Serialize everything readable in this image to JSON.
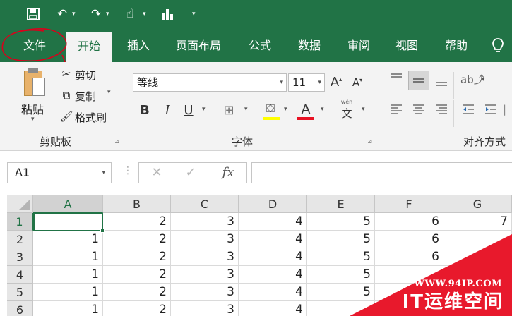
{
  "tabs": {
    "file": "文件",
    "home": "开始",
    "insert": "插入",
    "layout": "页面布局",
    "formulas": "公式",
    "data": "数据",
    "review": "审阅",
    "view": "视图",
    "help": "帮助"
  },
  "clipboard": {
    "paste": "粘贴",
    "cut": "剪切",
    "copy": "复制",
    "format_painter": "格式刷",
    "group_label": "剪贴板"
  },
  "font": {
    "name": "等线",
    "size": "11",
    "bold": "B",
    "italic": "I",
    "underline": "U",
    "font_color_glyph": "A",
    "phonetic_top": "wén",
    "phonetic_bottom": "文",
    "group_label": "字体",
    "fill_color": "#ffff00",
    "font_color": "#e81123"
  },
  "alignment": {
    "group_label": "对齐方式"
  },
  "formula_bar": {
    "name_box": "A1",
    "cancel": "✕",
    "enter": "✓",
    "fx": "fx",
    "value": ""
  },
  "sheet": {
    "columns": [
      "A",
      "B",
      "C",
      "D",
      "E",
      "F",
      "G"
    ],
    "rows": [
      {
        "num": "1",
        "cells": [
          "",
          "2",
          "3",
          "4",
          "5",
          "6",
          "7"
        ]
      },
      {
        "num": "2",
        "cells": [
          "1",
          "2",
          "3",
          "4",
          "5",
          "6",
          ""
        ]
      },
      {
        "num": "3",
        "cells": [
          "1",
          "2",
          "3",
          "4",
          "5",
          "6",
          ""
        ]
      },
      {
        "num": "4",
        "cells": [
          "1",
          "2",
          "3",
          "4",
          "5",
          "",
          ""
        ]
      },
      {
        "num": "5",
        "cells": [
          "1",
          "2",
          "3",
          "4",
          "5",
          "",
          ""
        ]
      },
      {
        "num": "6",
        "cells": [
          "1",
          "2",
          "3",
          "4",
          "",
          "",
          ""
        ]
      }
    ],
    "active_cell": "A1"
  },
  "watermark": {
    "url": "WWW.94IP.COM",
    "name": "IT运维空间"
  },
  "colors": {
    "accent": "#217346",
    "annotation": "#d9001b",
    "watermark": "#e8192c"
  }
}
